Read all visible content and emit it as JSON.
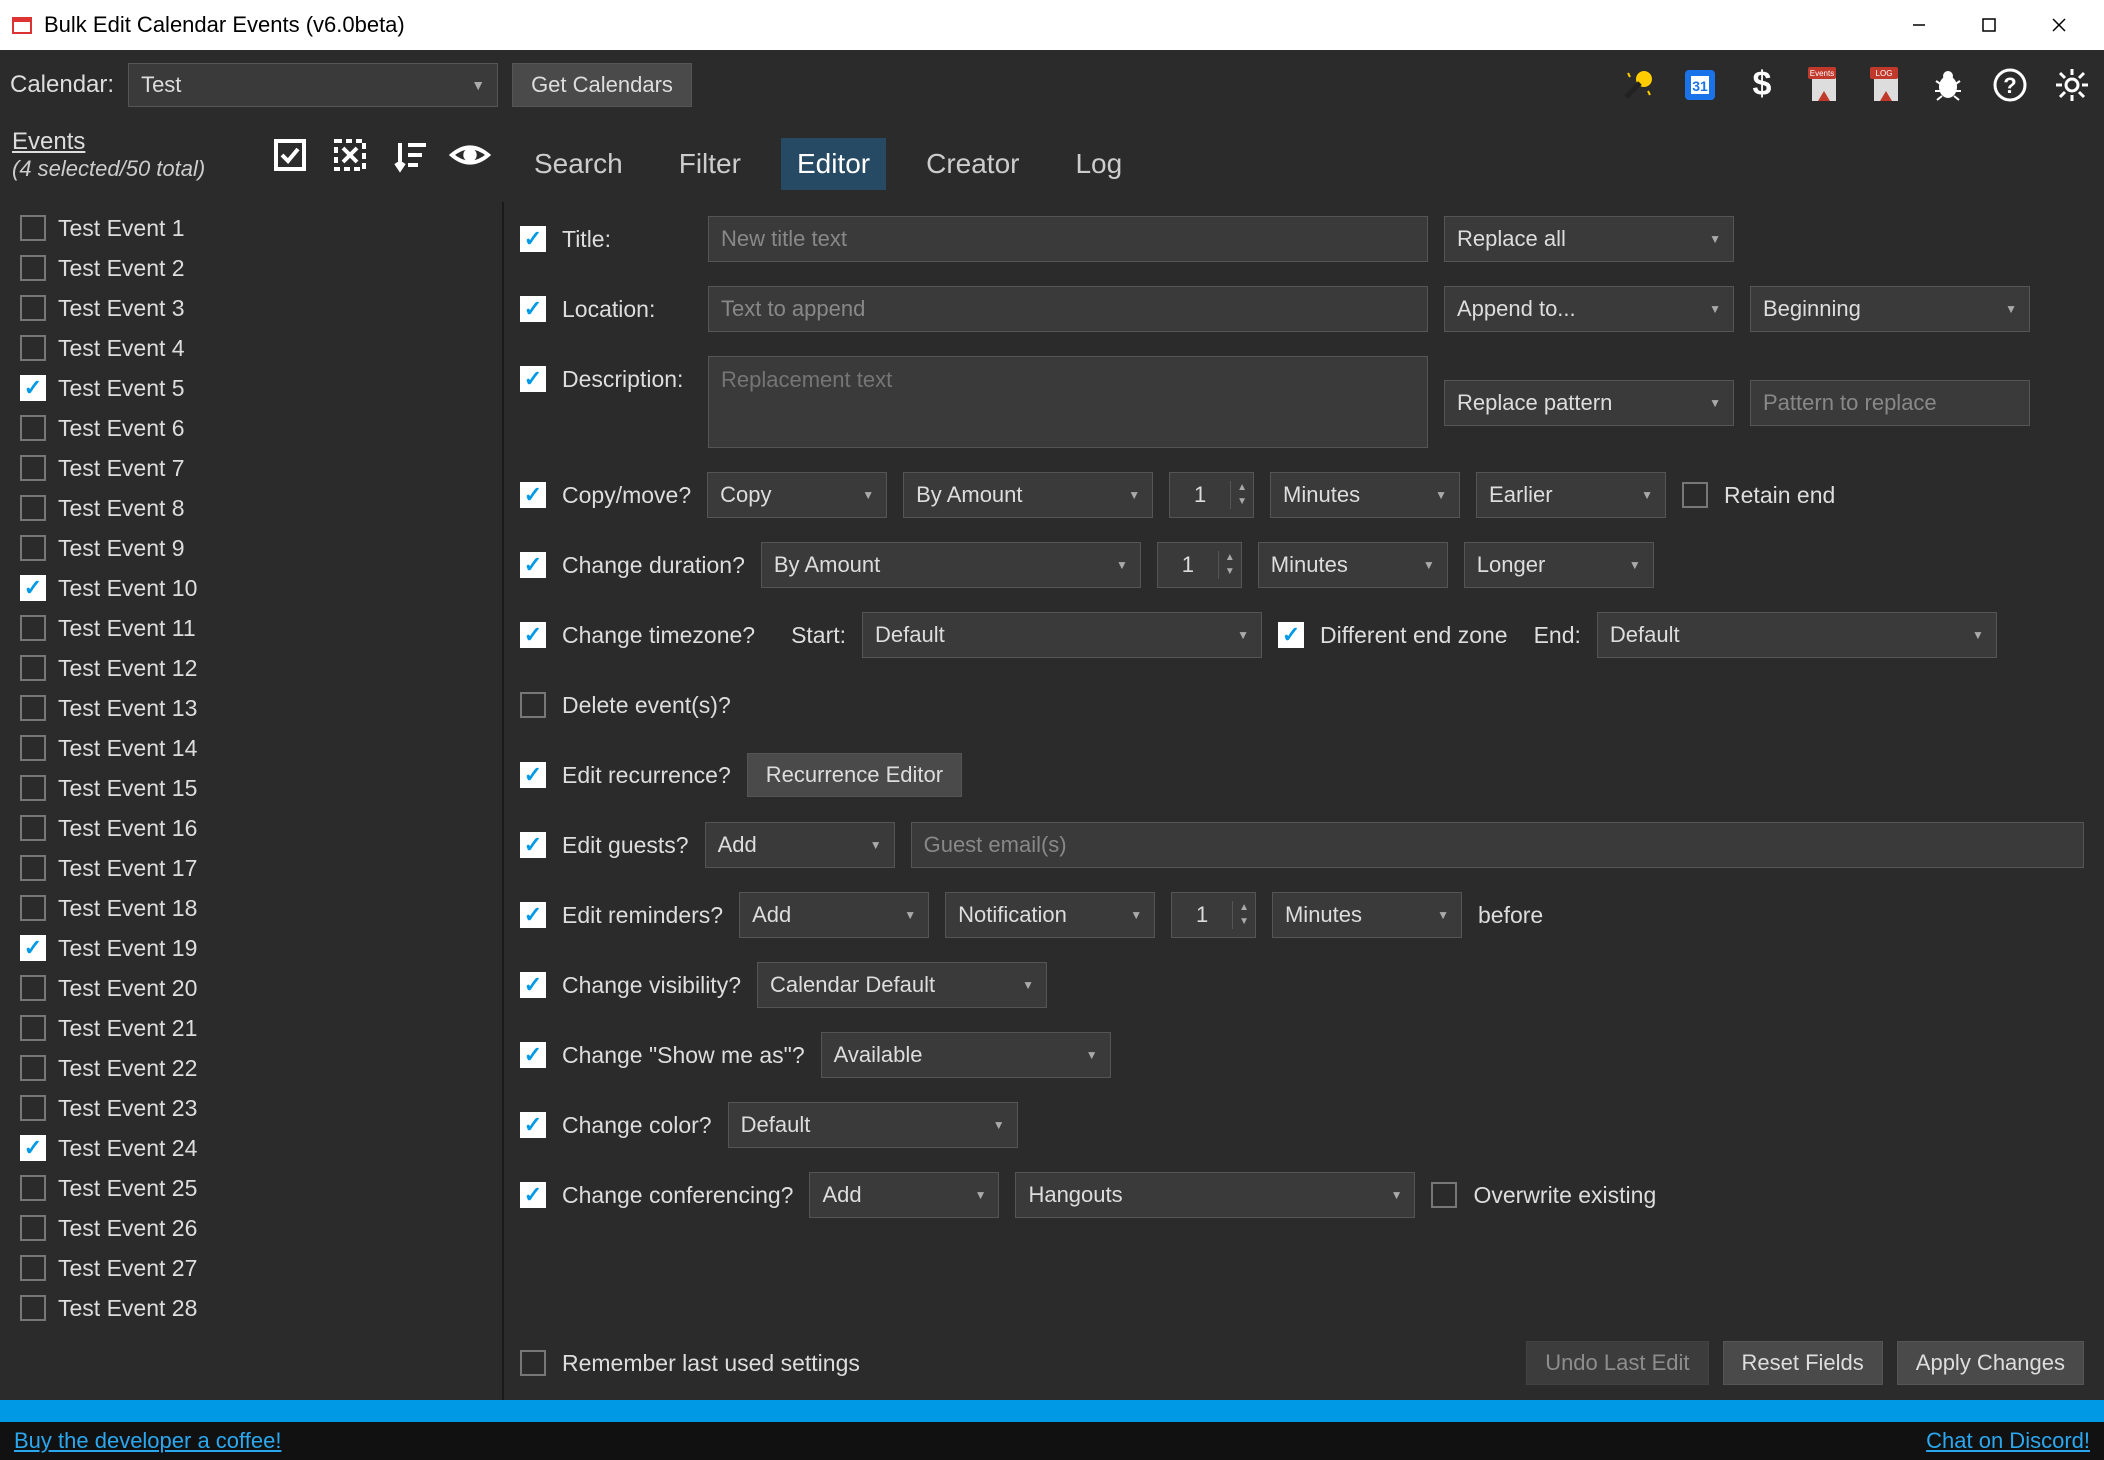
{
  "window": {
    "title": "Bulk Edit Calendar Events (v6.0beta)"
  },
  "toolbar": {
    "calendar_label": "Calendar:",
    "calendar_value": "Test",
    "get_calendars": "Get Calendars"
  },
  "sidebar": {
    "events_link": "Events",
    "events_sub": "(4 selected/50 total)"
  },
  "tabs": {
    "search": "Search",
    "filter": "Filter",
    "editor": "Editor",
    "creator": "Creator",
    "log": "Log"
  },
  "events": [
    {
      "label": "Test Event 1",
      "checked": false
    },
    {
      "label": "Test Event 2",
      "checked": false
    },
    {
      "label": "Test Event 3",
      "checked": false
    },
    {
      "label": "Test Event 4",
      "checked": false
    },
    {
      "label": "Test Event 5",
      "checked": true
    },
    {
      "label": "Test Event 6",
      "checked": false
    },
    {
      "label": "Test Event 7",
      "checked": false
    },
    {
      "label": "Test Event 8",
      "checked": false
    },
    {
      "label": "Test Event 9",
      "checked": false
    },
    {
      "label": "Test Event 10",
      "checked": true
    },
    {
      "label": "Test Event 11",
      "checked": false
    },
    {
      "label": "Test Event 12",
      "checked": false
    },
    {
      "label": "Test Event 13",
      "checked": false
    },
    {
      "label": "Test Event 14",
      "checked": false
    },
    {
      "label": "Test Event 15",
      "checked": false
    },
    {
      "label": "Test Event 16",
      "checked": false
    },
    {
      "label": "Test Event 17",
      "checked": false
    },
    {
      "label": "Test Event 18",
      "checked": false
    },
    {
      "label": "Test Event 19",
      "checked": true
    },
    {
      "label": "Test Event 20",
      "checked": false
    },
    {
      "label": "Test Event 21",
      "checked": false
    },
    {
      "label": "Test Event 22",
      "checked": false
    },
    {
      "label": "Test Event 23",
      "checked": false
    },
    {
      "label": "Test Event 24",
      "checked": true
    },
    {
      "label": "Test Event 25",
      "checked": false
    },
    {
      "label": "Test Event 26",
      "checked": false
    },
    {
      "label": "Test Event 27",
      "checked": false
    },
    {
      "label": "Test Event 28",
      "checked": false
    }
  ],
  "editor": {
    "title": {
      "checked": true,
      "label": "Title:",
      "placeholder": "New title text",
      "mode": "Replace all"
    },
    "location": {
      "checked": true,
      "label": "Location:",
      "placeholder": "Text to append",
      "mode": "Append to...",
      "pos": "Beginning"
    },
    "description": {
      "checked": true,
      "label": "Description:",
      "placeholder": "Replacement text",
      "mode": "Replace pattern",
      "pattern_placeholder": "Pattern to replace"
    },
    "copymove": {
      "checked": true,
      "label": "Copy/move?",
      "action": "Copy",
      "by": "By Amount",
      "amount": "1",
      "unit": "Minutes",
      "dir": "Earlier",
      "retain_label": "Retain end",
      "retain_checked": false
    },
    "duration": {
      "checked": true,
      "label": "Change duration?",
      "by": "By Amount",
      "amount": "1",
      "unit": "Minutes",
      "dir": "Longer"
    },
    "timezone": {
      "checked": true,
      "label": "Change timezone?",
      "start_label": "Start:",
      "start_val": "Default",
      "diff_checked": true,
      "diff_label": "Different end zone",
      "end_label": "End:",
      "end_val": "Default"
    },
    "delete": {
      "checked": false,
      "label": "Delete event(s)?"
    },
    "recurrence": {
      "checked": true,
      "label": "Edit recurrence?",
      "button": "Recurrence Editor"
    },
    "guests": {
      "checked": true,
      "label": "Edit guests?",
      "action": "Add",
      "placeholder": "Guest email(s)"
    },
    "reminders": {
      "checked": true,
      "label": "Edit reminders?",
      "action": "Add",
      "type": "Notification",
      "amount": "1",
      "unit": "Minutes",
      "before": "before"
    },
    "visibility": {
      "checked": true,
      "label": "Change visibility?",
      "val": "Calendar Default"
    },
    "showmeas": {
      "checked": true,
      "label": "Change \"Show me as\"?",
      "val": "Available"
    },
    "color": {
      "checked": true,
      "label": "Change color?",
      "val": "Default"
    },
    "conferencing": {
      "checked": true,
      "label": "Change conferencing?",
      "action": "Add",
      "val": "Hangouts",
      "overwrite_checked": false,
      "overwrite_label": "Overwrite existing"
    },
    "remember": {
      "checked": false,
      "label": "Remember last used settings"
    },
    "buttons": {
      "undo": "Undo Last Edit",
      "reset": "Reset Fields",
      "apply": "Apply Changes"
    }
  },
  "footer": {
    "coffee": "Buy the developer a coffee!",
    "discord": "Chat on Discord!"
  }
}
